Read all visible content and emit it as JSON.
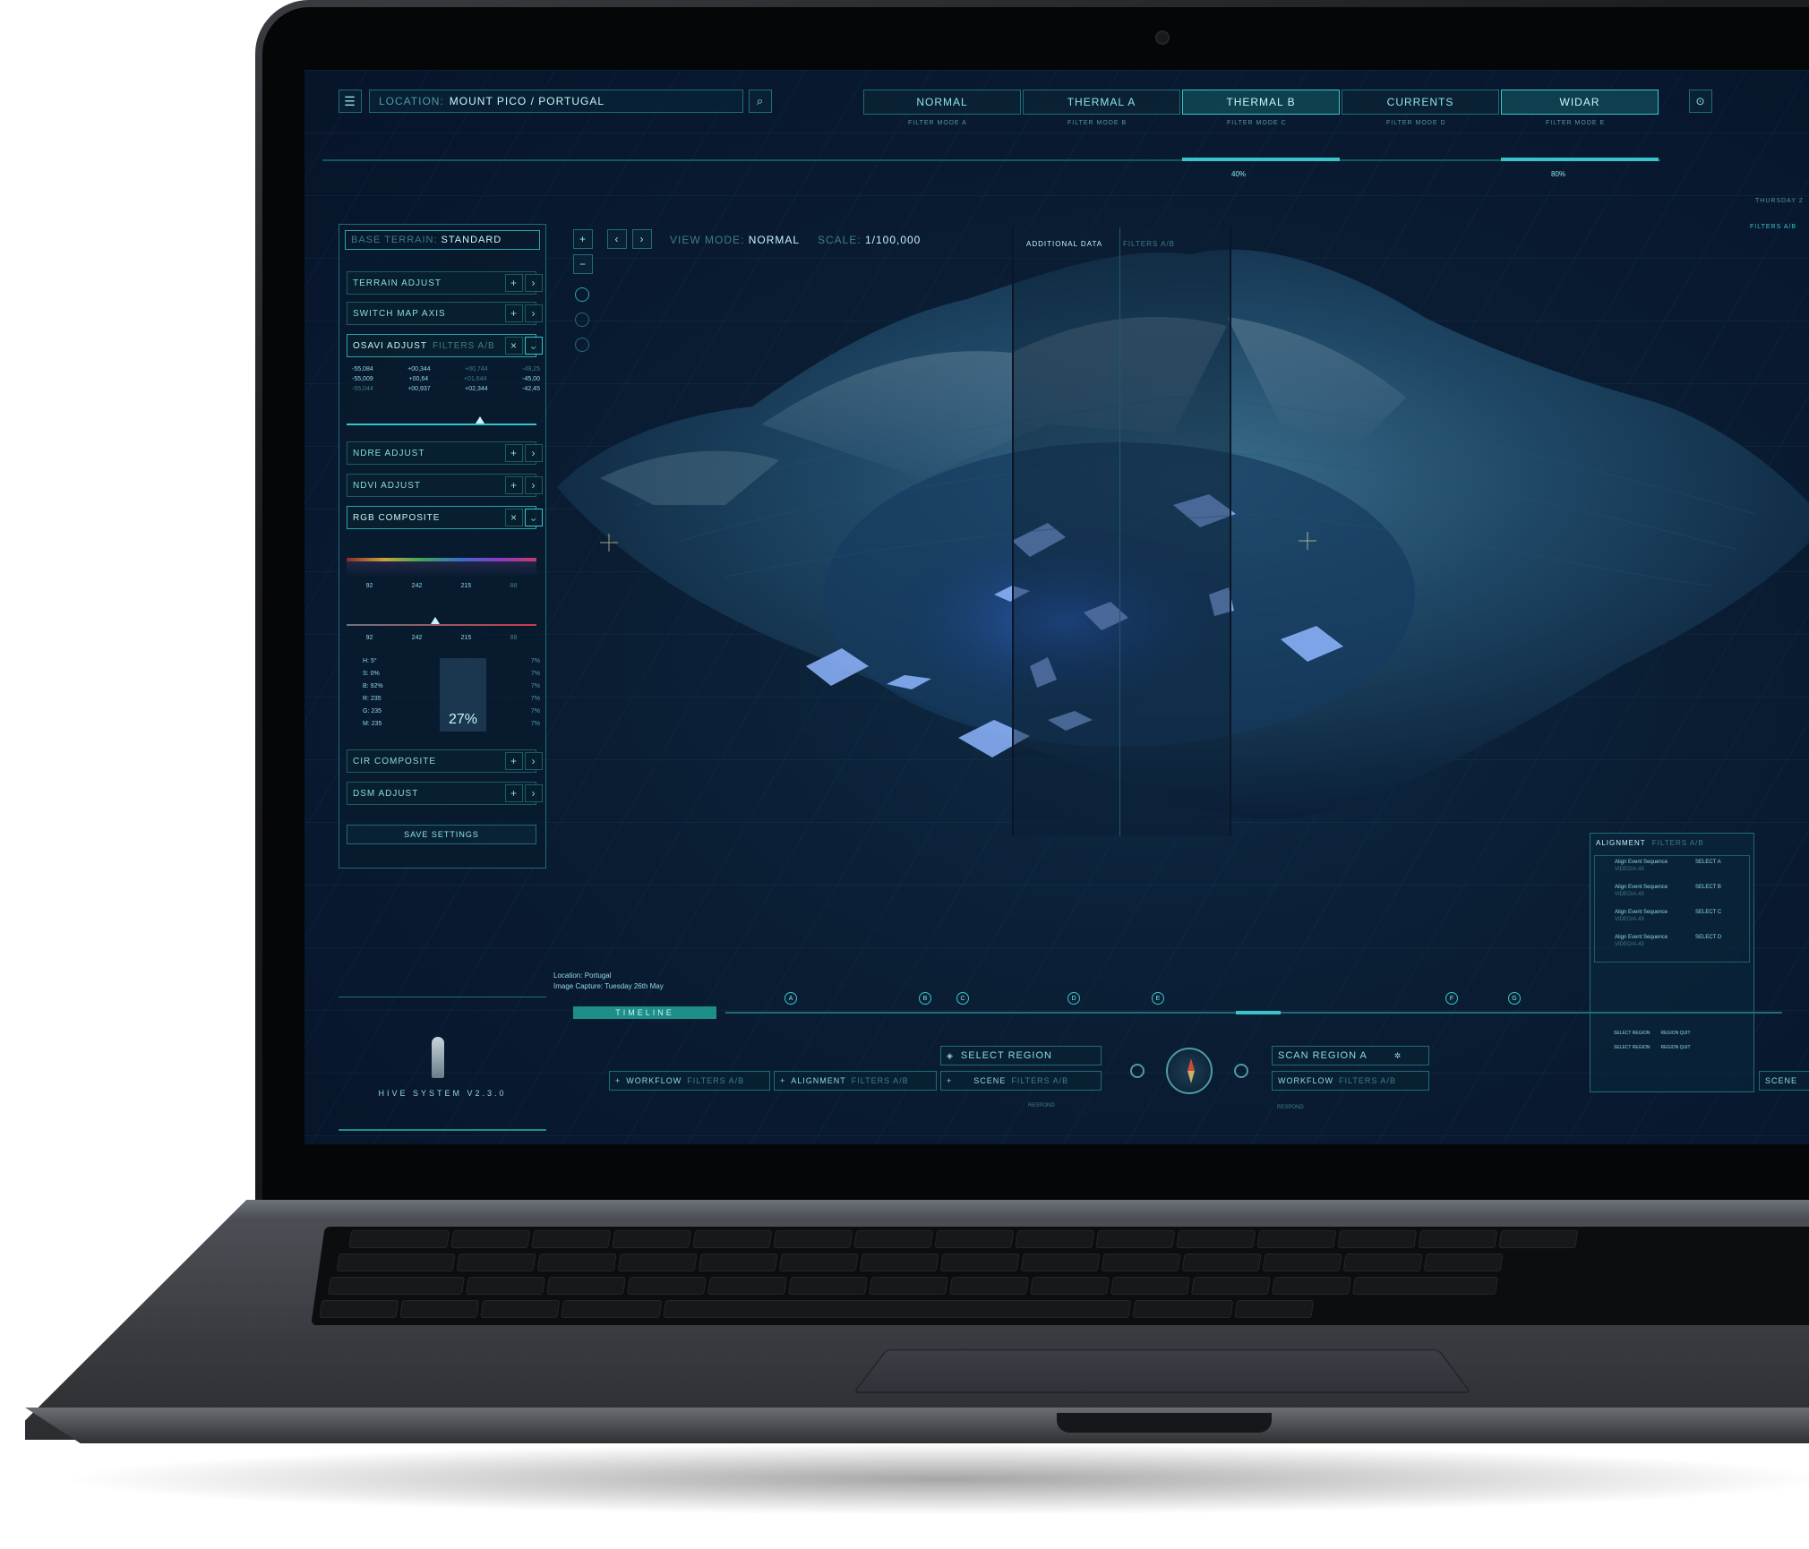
{
  "app": {
    "location_label": "LOCATION:",
    "location_value": "MOUNT PICO / PORTUGAL",
    "day_label": "THURSDAY 2"
  },
  "filter_tabs": [
    {
      "label": "NORMAL",
      "sub": "FILTER MODE A",
      "active": false
    },
    {
      "label": "THERMAL A",
      "sub": "FILTER MODE B",
      "active": false
    },
    {
      "label": "THERMAL B",
      "sub": "FILTER MODE C",
      "active": true
    },
    {
      "label": "CURRENTS",
      "sub": "FILTER MODE D",
      "active": false
    },
    {
      "label": "WIDAR",
      "sub": "FILTER MODE E",
      "active": true
    }
  ],
  "filter_levels": {
    "thermal_b": "40%",
    "widar": "80%"
  },
  "view": {
    "mode_label": "VIEW MODE:",
    "mode_value": "NORMAL",
    "scale_label": "SCALE:",
    "scale_value": "1/100,000"
  },
  "left_panel": {
    "base_terrain_label": "BASE TERRAIN:",
    "base_terrain_value": "STANDARD",
    "rows": {
      "terrain_adjust": "TERRAIN ADJUST",
      "switch_map_axis": "SWITCH MAP AXIS",
      "osavi_adjust": "OSAVI ADJUST",
      "osavi_filter": "FILTERS A/B",
      "ndre_adjust": "NDRE ADJUST",
      "ndvi_adjust": "NDVI ADJUST",
      "rgb_composite": "RGB COMPOSITE",
      "cir_composite": "CIR COMPOSITE",
      "dsm_adjust": "DSM ADJUST"
    },
    "osavi_values": [
      [
        "-55,084",
        "+00,344",
        "+00,744",
        "-49,25"
      ],
      [
        "-55,009",
        "+00,64",
        "+01,644",
        "-45,00"
      ],
      [
        "-55,044",
        "+00,937",
        "+02,344",
        "-42,45"
      ]
    ],
    "rgb_slider_values": [
      "92",
      "242",
      "",
      "215",
      "88"
    ],
    "rgb_slider_values_2": [
      "92",
      "242",
      "",
      "215",
      "88"
    ],
    "channels": [
      {
        "label": "H:",
        "value": "5°",
        "pct": "7%"
      },
      {
        "label": "S:",
        "value": "0%",
        "pct": "7%"
      },
      {
        "label": "B:",
        "value": "92%",
        "pct": "7%"
      },
      {
        "label": "R:",
        "value": "235",
        "pct": "7%"
      },
      {
        "label": "G:",
        "value": "235",
        "pct": "7%"
      },
      {
        "label": "M:",
        "value": "235",
        "pct": "7%"
      }
    ],
    "big_value": "27%",
    "save_button": "SAVE SETTINGS"
  },
  "overlay": {
    "additional_data": "ADDITIONAL DATA",
    "filters": "FILTERS A/B",
    "right_filter": "FILTERS A/B"
  },
  "alignment_panel": {
    "title": "ALIGNMENT",
    "filter": "FILTERS A/B",
    "items": [
      {
        "label": "Align Event Sequence",
        "sub": "VIDEO/A.43",
        "select": "SELECT A"
      },
      {
        "label": "Align Event Sequence",
        "sub": "VIDEO/A.43",
        "select": "SELECT B"
      },
      {
        "label": "Align Event Sequence",
        "sub": "VIDEO/A.43",
        "select": "SELECT C"
      },
      {
        "label": "Align Event Sequence",
        "sub": "VIDEO/A.43",
        "select": "SELECT D"
      }
    ],
    "region_rows": [
      {
        "a": "SELECT REGION",
        "b": "REGION QUIT"
      },
      {
        "a": "SELECT REGION",
        "b": "REGION QUIT"
      }
    ]
  },
  "image_info": {
    "location": "Location: Portugal",
    "capture": "Image Capture: Tuesday 26th May"
  },
  "timeline": {
    "label": "TIMELINE",
    "markers": [
      "A",
      "B",
      "C",
      "D",
      "E",
      "F",
      "G"
    ]
  },
  "hive": {
    "label": "HIVE SYSTEM V2.3.0"
  },
  "bottom": {
    "select_region": "SELECT REGION",
    "scan_region": "SCAN REGION A",
    "workflow": "WORKFLOW",
    "alignment": "ALIGNMENT",
    "scene": "SCENE",
    "filter": "FILTERS A/B",
    "respond": "RESPOND",
    "scene_right": "SCENE"
  },
  "colors": {
    "accent": "#39c4cc",
    "screen_bg": "#0a1d33",
    "panel_border": "#1e6d77",
    "text": "#8fe3ea"
  }
}
